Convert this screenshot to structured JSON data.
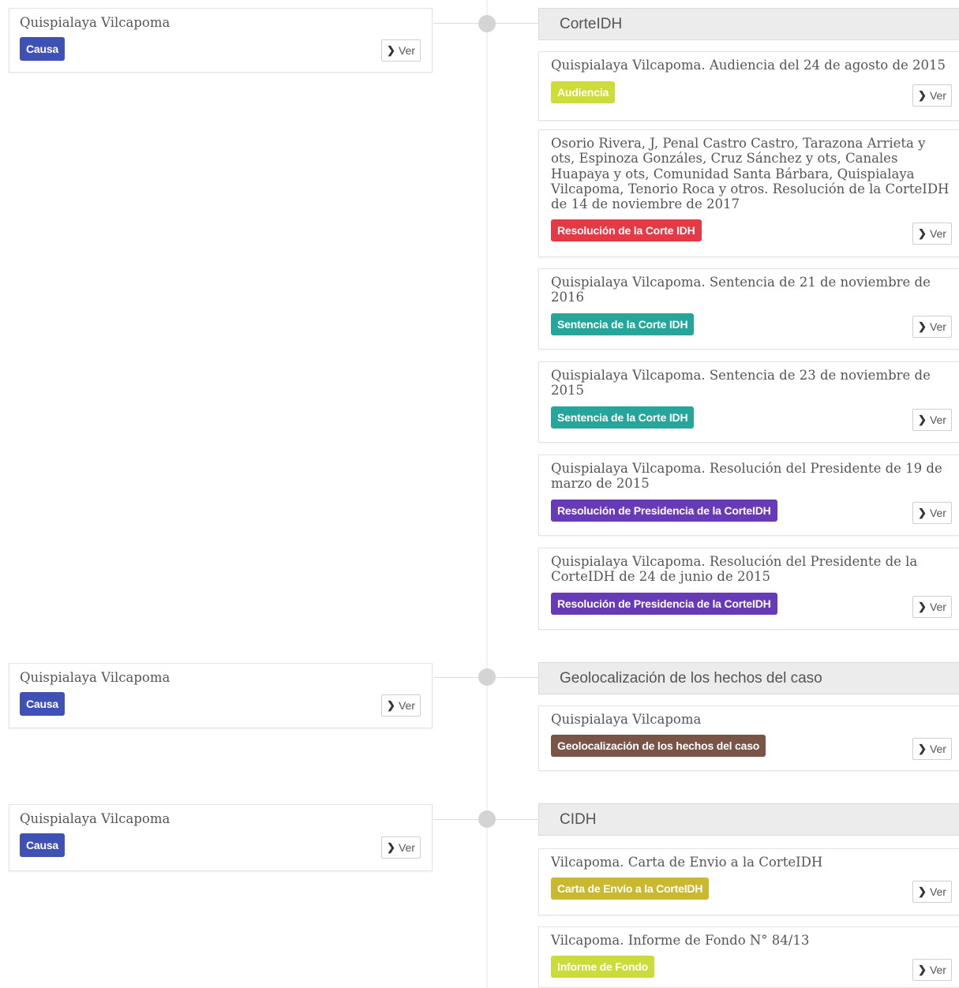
{
  "rows": [
    {
      "causa": {
        "title": "Quispialaya Vilcapoma",
        "badge": "Causa",
        "ver": "Ver"
      },
      "group": "CorteIDH",
      "docs": [
        {
          "title": "Quispialaya Vilcapoma. Audiencia del 24 de agosto de 2015",
          "badge": "Audiencia",
          "ver": "Ver"
        },
        {
          "title": "Osorio Rivera, J, Penal Castro Castro, Tarazona Arrieta y ots, Espinoza Gonzáles, Cruz Sánchez y ots, Canales Huapaya y ots, Comunidad Santa Bárbara, Quispialaya Vilcapoma, Tenorio Roca y otros. Resolución de la CorteIDH de 14 de noviembre de 2017",
          "badge": "Resolución de la Corte IDH",
          "ver": "Ver"
        },
        {
          "title": "Quispialaya Vilcapoma. Sentencia de 21 de noviembre de 2016",
          "badge": "Sentencia de la Corte IDH",
          "ver": "Ver"
        },
        {
          "title": "Quispialaya Vilcapoma. Sentencia de 23 de noviembre de 2015",
          "badge": "Sentencia de la Corte IDH",
          "ver": "Ver"
        },
        {
          "title": "Quispialaya Vilcapoma. Resolución del Presidente de 19 de marzo de 2015",
          "badge": "Resolución de Presidencia de la CorteIDH",
          "ver": "Ver"
        },
        {
          "title": "Quispialaya Vilcapoma. Resolución del Presidente de la CorteIDH de 24 de junio de 2015",
          "badge": "Resolución de Presidencia de la CorteIDH",
          "ver": "Ver"
        }
      ]
    },
    {
      "causa": {
        "title": "Quispialaya Vilcapoma",
        "badge": "Causa",
        "ver": "Ver"
      },
      "group": "Geolocalización de los hechos del caso",
      "docs": [
        {
          "title": "Quispialaya Vilcapoma",
          "badge": "Geolocalización de los hechos del caso",
          "ver": "Ver"
        }
      ]
    },
    {
      "causa": {
        "title": "Quispialaya Vilcapoma",
        "badge": "Causa",
        "ver": "Ver"
      },
      "group": "CIDH",
      "docs": [
        {
          "title": "Vilcapoma. Carta de Envio a la CorteIDH",
          "badge": "Carta de Envío a la CorteIDH",
          "ver": "Ver"
        },
        {
          "title": "Vilcapoma. Informe de Fondo N° 84/13",
          "badge": "Informe de Fondo",
          "ver": "Ver"
        }
      ]
    }
  ],
  "colors": {
    "causa": "#3f51b5",
    "audiencia": "#cddc39",
    "resolucion_corte": "#e53946",
    "sentencia": "#26a69a",
    "presidencia": "#673ab7",
    "geolocalizacion": "#795548",
    "carta": "#cbb831",
    "informe": "#c9dc3b"
  },
  "icons": {
    "ver_button": "chevron-right-icon"
  }
}
